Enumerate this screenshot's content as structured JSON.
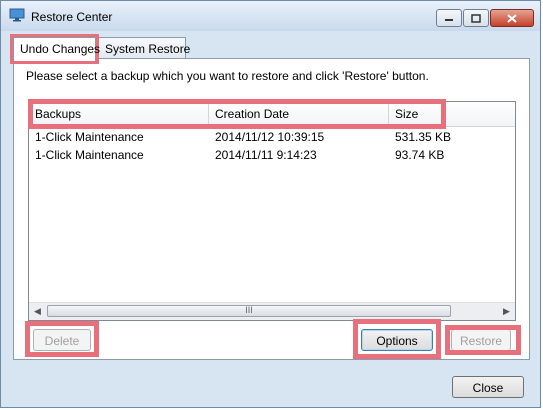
{
  "window": {
    "title": "Restore Center"
  },
  "tabs": [
    {
      "label": "Undo Changes"
    },
    {
      "label": "System Restore"
    }
  ],
  "panel": {
    "instructions": "Please select a backup which you want to restore and click 'Restore' button.",
    "columns": [
      "Backups",
      "Creation Date",
      "Size"
    ],
    "rows": [
      {
        "name": "1-Click Maintenance",
        "date": "2014/11/12 10:39:15",
        "size": "531.35 KB"
      },
      {
        "name": "1-Click Maintenance",
        "date": "2014/11/11 9:14:23",
        "size": "93.74 KB"
      }
    ],
    "scroll_grip": "III"
  },
  "buttons": {
    "delete": "Delete",
    "options": "Options",
    "restore": "Restore",
    "close": "Close"
  },
  "colors": {
    "highlight": "#e8707d",
    "titlebar": "#c9d9ec"
  }
}
